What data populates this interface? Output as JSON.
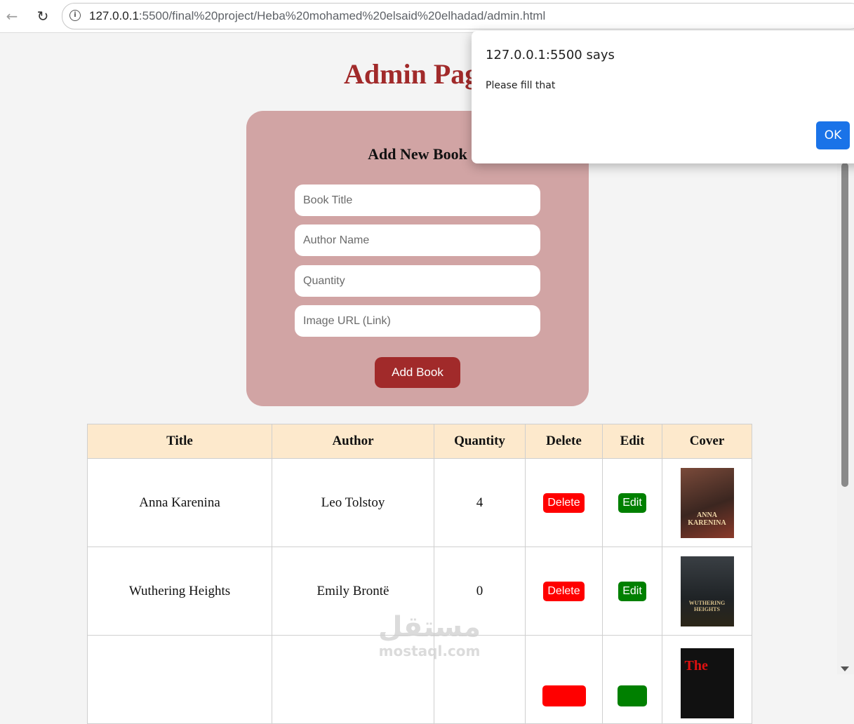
{
  "browser": {
    "url_host": "127.0.0.1",
    "url_rest": ":5500/final%20project/Heba%20mohamed%20elsaid%20elhadad/admin.html"
  },
  "page": {
    "title": "Admin Page"
  },
  "form": {
    "title": "Add New Book",
    "title_placeholder": "Book Title",
    "author_placeholder": "Author Name",
    "quantity_placeholder": "Quantity",
    "image_placeholder": "Image URL (Link)",
    "submit_label": "Add Book"
  },
  "table": {
    "headers": [
      "Title",
      "Author",
      "Quantity",
      "Delete",
      "Edit",
      "Cover"
    ],
    "rows": [
      {
        "title": "Anna Karenina",
        "author": "Leo Tolstoy",
        "quantity": "4",
        "delete": "Delete",
        "edit": "Edit",
        "cover_text": "ANNA KARENINA"
      },
      {
        "title": "Wuthering Heights",
        "author": "Emily Brontë",
        "quantity": "0",
        "delete": "Delete",
        "edit": "Edit",
        "cover_text": "WUTHERING HEIGHTS"
      },
      {
        "title": "",
        "author": "",
        "quantity": "",
        "delete": "",
        "edit": "",
        "cover_text": "The"
      }
    ]
  },
  "dialog": {
    "title": "127.0.0.1:5500 says",
    "message": "Please fill that",
    "ok_label": "OK"
  },
  "watermark": {
    "arabic": "مستقل",
    "latin": "mostaql.com"
  },
  "colors": {
    "accent": "#a12a2a",
    "card": "#d1a4a4",
    "header": "#fde9cc",
    "delete": "#ff0000",
    "edit": "#008000",
    "ok": "#1a73e8"
  }
}
